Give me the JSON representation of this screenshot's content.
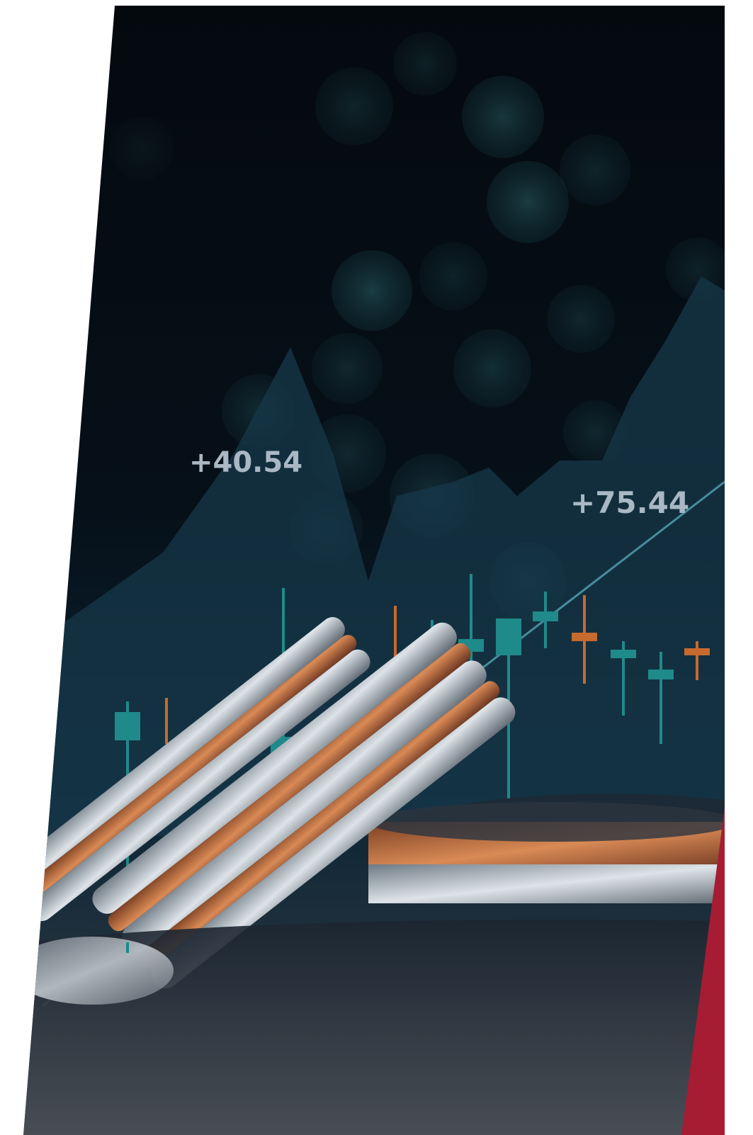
{
  "image": {
    "labels": [
      "+40.54",
      "+75.44"
    ]
  },
  "colors": {
    "page_background": "#ffffff",
    "photo_background_dark": "#050b11",
    "teal_glow": "#2a6a6e",
    "candle_up": "#1f8a8a",
    "candle_down": "#c76a2e",
    "accent_red": "#a61c33",
    "coin_silver": "#b9c0c8",
    "coin_copper": "#b86a3c"
  }
}
